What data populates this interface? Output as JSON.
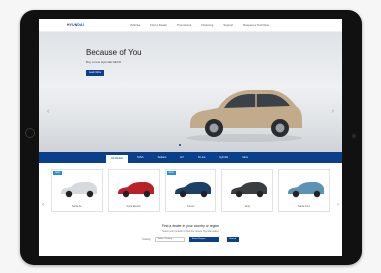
{
  "header": {
    "logo": "HYUNDAI",
    "nav_links": [
      "Vehicles",
      "Find a Dealer",
      "Promotions",
      "Financing",
      "Support",
      "Request a Test Drive"
    ]
  },
  "hero": {
    "title": "Because of You",
    "subtitle": "Buy a new Hyundai NEXO",
    "button": "Learn More",
    "car_color": "#c2ab8a"
  },
  "tabs": [
    {
      "label": "All Models",
      "active": true
    },
    {
      "label": "SUVs",
      "active": false
    },
    {
      "label": "Sedans",
      "active": false
    },
    {
      "label": "EV",
      "active": false
    },
    {
      "label": "N Line",
      "active": false
    },
    {
      "label": "Hybrids",
      "active": false
    },
    {
      "label": "Vans",
      "active": false
    }
  ],
  "models": [
    {
      "name": "Santa Fe",
      "badge": "NEW",
      "color": "#d6d9dd"
    },
    {
      "name": "Kona Electric",
      "badge": "",
      "color": "#b8202a"
    },
    {
      "name": "Tucson",
      "badge": "NEW",
      "color": "#1e3f66"
    },
    {
      "name": "Ioniq",
      "badge": "",
      "color": "#3a3d42"
    },
    {
      "name": "Santa Cruz",
      "badge": "",
      "color": "#5a93b5"
    }
  ],
  "dealer": {
    "heading": "Find a dealer in your country or region",
    "text": "Select your location to find the closest Hyundai dealer",
    "country_label": "Country",
    "country_value": "Select Country",
    "region_value": "Select Region",
    "button": "Search"
  },
  "colors": {
    "brand": "#0a3f8c",
    "badge": "#2b8fd6"
  }
}
